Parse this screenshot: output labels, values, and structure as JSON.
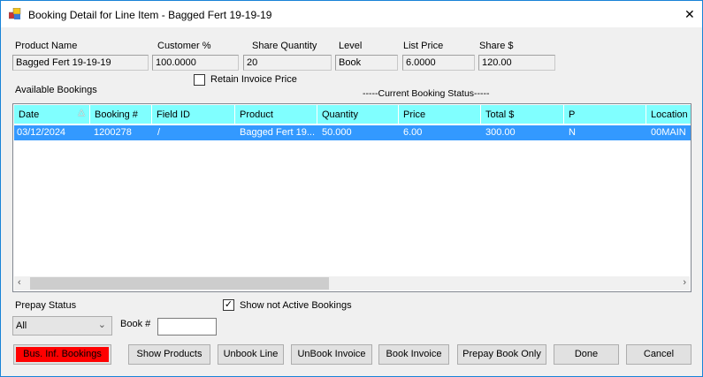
{
  "window": {
    "title": "Booking Detail for Line Item - Bagged Fert 19-19-19",
    "close": "✕"
  },
  "fields": {
    "product_name": {
      "label": "Product Name",
      "value": "Bagged Fert 19-19-19"
    },
    "customer_pct": {
      "label": "Customer %",
      "value": "100.0000"
    },
    "share_quantity": {
      "label": "Share Quantity",
      "value": "20"
    },
    "level": {
      "label": "Level",
      "value": "Book"
    },
    "list_price": {
      "label": "List Price",
      "value": "6.0000"
    },
    "share_dollars": {
      "label": "Share $",
      "value": "120.00"
    }
  },
  "retain_invoice_price": {
    "label": "Retain Invoice Price",
    "checked": false
  },
  "available_bookings_label": "Available Bookings",
  "current_status_label": "-----Current Booking Status-----",
  "grid": {
    "columns": [
      "Date",
      "Booking #",
      "Field ID",
      "Product",
      "Quantity",
      "Price",
      "Total $",
      "P",
      "Location"
    ],
    "rows": [
      [
        "03/12/2024",
        "1200278",
        "/",
        "Bagged Fert 19...",
        "50.000",
        "6.00",
        "300.00",
        "N",
        "00MAIN"
      ]
    ]
  },
  "prepay_status": {
    "label": "Prepay Status",
    "value": "All"
  },
  "show_not_active": {
    "label": "Show not Active Bookings",
    "checked": true,
    "mark": "✓"
  },
  "book_num": {
    "label": "Book #",
    "value": ""
  },
  "buttons": {
    "bus_inf": "Bus. Inf. Bookings",
    "show_products": "Show Products",
    "unbook_line": "Unbook Line",
    "unbook_invoice": "UnBook Invoice",
    "book_invoice": "Book Invoice",
    "prepay_book_only": "Prepay Book Only",
    "done": "Done",
    "cancel": "Cancel"
  },
  "colors": {
    "header": "#80ffff",
    "selection": "#3399ff",
    "bus_inf": "#ff0000"
  }
}
